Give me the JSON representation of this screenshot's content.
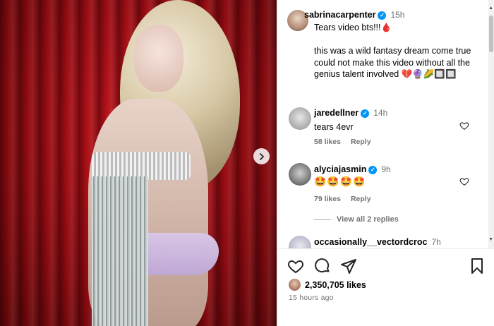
{
  "post": {
    "author": "sabrinacarpenter",
    "time": "15h",
    "caption": "Tears video bts!!!🩸\n\nthis was a wild fantasy dream come true\ncould not make this video without all the genius talent involved 💔🔮🌽🔲🔲"
  },
  "comments": [
    {
      "user": "jaredellner",
      "time": "14h",
      "text": "tears 4evr",
      "likes": "58 likes",
      "reply": "Reply"
    },
    {
      "user": "alyciajasmin",
      "time": "9h",
      "text": "🤩🤩🤩🤩",
      "likes": "79 likes",
      "reply": "Reply",
      "view_replies": "View all 2 replies"
    },
    {
      "user": "occasionally__vectordcroc",
      "time": "7h"
    }
  ],
  "footer": {
    "likes": "2,350,705 likes",
    "posted": "15 hours ago"
  },
  "icons": {
    "like": "heart-icon",
    "comment": "comment-icon",
    "share": "send-icon",
    "save": "bookmark-icon",
    "next": "chevron-right-icon"
  },
  "colors": {
    "verified": "#0095f6",
    "secondary_text": "#737373",
    "backdrop": "#a10d14"
  }
}
